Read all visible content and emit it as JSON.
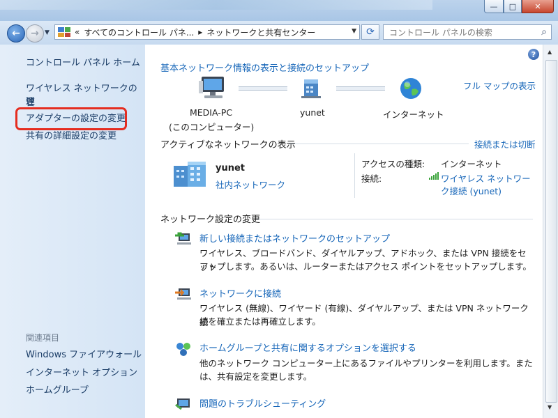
{
  "window": {
    "minimize_glyph": "—",
    "maximize_glyph": "□",
    "close_glyph": "✕"
  },
  "nav": {
    "back_glyph": "←",
    "forward_glyph": "→",
    "address_prefix": "«",
    "breadcrumb_1": "すべてのコントロール パネ...",
    "breadcrumb_sep": "▸",
    "breadcrumb_2": "ネットワークと共有センター",
    "search_placeholder": "コントロール パネルの検索"
  },
  "sidebar": {
    "home": "コントロール パネル ホーム",
    "wireless_line1": "ワイヤレス ネットワークの管",
    "wireless_line2": "理",
    "adapter": "アダプターの設定の変更",
    "sharing": "共有の詳細設定の変更",
    "related_heading": "関連項目",
    "related": [
      "Windows ファイアウォール",
      "インターネット オプション",
      "ホームグループ"
    ]
  },
  "main": {
    "title": "基本ネットワーク情報の表示と接続のセットアップ",
    "full_map": "フル マップの表示",
    "map": {
      "pc_name": "MEDIA-PC",
      "pc_sub": "(このコンピューター)",
      "network": "yunet",
      "internet": "インターネット"
    },
    "active": {
      "heading": "アクティブなネットワークの表示",
      "connect_link": "接続または切断",
      "network_name": "yunet",
      "network_type": "社内ネットワーク",
      "access_label": "アクセスの種類:",
      "access_value": "インターネット",
      "connection_label": "接続:",
      "connection_value_1": "ワイヤレス ネットワー",
      "connection_value_2": "ク接続 (yunet)"
    },
    "change": {
      "heading": "ネットワーク設定の変更",
      "tasks": [
        {
          "title": "新しい接続またはネットワークのセットアップ",
          "desc1": "ワイヤレス、ブロードバンド、ダイヤルアップ、アドホック、または VPN 接続をセット",
          "desc2": "アップします。あるいは、ルーターまたはアクセス ポイントをセットアップします。"
        },
        {
          "title": "ネットワークに接続",
          "desc1": "ワイヤレス (無線)、ワイヤード (有線)、ダイヤルアップ、または VPN ネットワーク接",
          "desc2": "続を確立または再確立します。"
        },
        {
          "title": "ホームグループと共有に関するオプションを選択する",
          "desc1": "他のネットワーク コンピューター上にあるファイルやプリンターを利用します。また",
          "desc2": "は、共有設定を変更します。"
        },
        {
          "title": "問題のトラブルシューティング",
          "desc1": "",
          "desc2": ""
        }
      ]
    }
  },
  "help_glyph": "?",
  "colors": {
    "link": "#1565b8",
    "highlight": "#e52d20",
    "sidebar_link": "#1a3c66"
  }
}
